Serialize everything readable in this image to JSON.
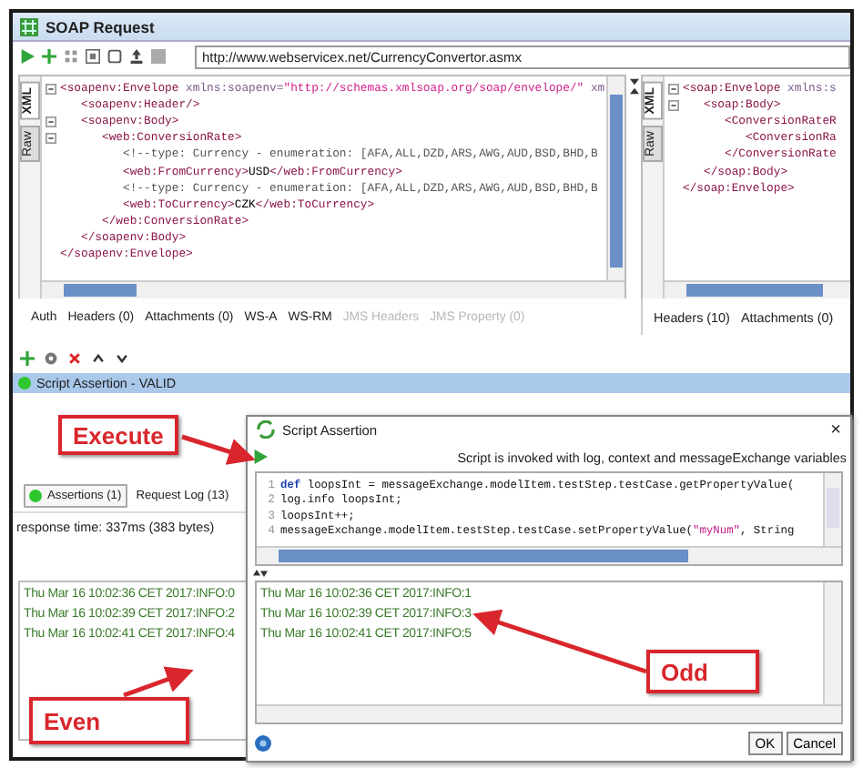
{
  "window": {
    "title": "SOAP Request"
  },
  "toolbar": {
    "url": "http://www.webservicex.net/CurrencyConvertor.asmx"
  },
  "request_pane": {
    "side_tabs": [
      {
        "label": "XML",
        "selected": true
      },
      {
        "label": "Raw",
        "selected": false
      }
    ],
    "lines": [
      {
        "fold": true,
        "parts": [
          {
            "kind": "tag",
            "text": "<soapenv:Envelope"
          },
          {
            "kind": "attr",
            "text": " xmlns:soapenv="
          },
          {
            "kind": "value",
            "text": "\"http://schemas.xmlsoap.org/soap/envelope/\""
          },
          {
            "kind": "attr",
            "text": " xm"
          }
        ]
      },
      {
        "fold": false,
        "parts": [
          {
            "kind": "tag",
            "text": "   <soapenv:Header/>"
          }
        ]
      },
      {
        "fold": true,
        "parts": [
          {
            "kind": "tag",
            "text": "   <soapenv:Body>"
          }
        ]
      },
      {
        "fold": true,
        "parts": [
          {
            "kind": "tag",
            "text": "      <web:ConversionRate>"
          }
        ]
      },
      {
        "fold": false,
        "parts": [
          {
            "kind": "comment",
            "text": "         <!--type: Currency - enumeration: [AFA,ALL,DZD,ARS,AWG,AUD,BSD,BHD,B"
          }
        ]
      },
      {
        "fold": false,
        "parts": [
          {
            "kind": "tag",
            "text": "         <web:FromCurrency>"
          },
          {
            "kind": "text",
            "text": "USD"
          },
          {
            "kind": "tag",
            "text": "</web:FromCurrency>"
          }
        ]
      },
      {
        "fold": false,
        "parts": [
          {
            "kind": "comment",
            "text": "         <!--type: Currency - enumeration: [AFA,ALL,DZD,ARS,AWG,AUD,BSD,BHD,B"
          }
        ]
      },
      {
        "fold": false,
        "parts": [
          {
            "kind": "tag",
            "text": "         <web:ToCurrency>"
          },
          {
            "kind": "text",
            "text": "CZK"
          },
          {
            "kind": "tag",
            "text": "</web:ToCurrency>"
          }
        ]
      },
      {
        "fold": false,
        "parts": [
          {
            "kind": "tag",
            "text": "      </web:ConversionRate>"
          }
        ]
      },
      {
        "fold": false,
        "parts": [
          {
            "kind": "tag",
            "text": "   </soapenv:Body>"
          }
        ]
      },
      {
        "fold": false,
        "parts": [
          {
            "kind": "tag",
            "text": "</soapenv:Envelope>"
          }
        ]
      }
    ]
  },
  "response_pane": {
    "side_tabs": [
      {
        "label": "XML",
        "selected": true
      },
      {
        "label": "Raw",
        "selected": false
      }
    ],
    "lines": [
      {
        "fold": true,
        "parts": [
          {
            "kind": "tag",
            "text": "<soap:Envelope"
          },
          {
            "kind": "attr",
            "text": " xmlns:s"
          }
        ]
      },
      {
        "fold": true,
        "parts": [
          {
            "kind": "tag",
            "text": "   <soap:Body>"
          }
        ]
      },
      {
        "fold": false,
        "parts": [
          {
            "kind": "tag",
            "text": "      <ConversionRateR"
          }
        ]
      },
      {
        "fold": false,
        "parts": [
          {
            "kind": "tag",
            "text": "         <ConversionRa"
          }
        ]
      },
      {
        "fold": false,
        "parts": [
          {
            "kind": "tag",
            "text": "      </ConversionRate"
          }
        ]
      },
      {
        "fold": false,
        "parts": [
          {
            "kind": "tag",
            "text": "   </soap:Body>"
          }
        ]
      },
      {
        "fold": false,
        "parts": [
          {
            "kind": "tag",
            "text": "</soap:Envelope>"
          }
        ]
      }
    ]
  },
  "request_tabs": [
    {
      "label": "Auth",
      "disabled": false
    },
    {
      "label": "Headers (0)",
      "disabled": false
    },
    {
      "label": "Attachments (0)",
      "disabled": false
    },
    {
      "label": "WS-A",
      "disabled": false
    },
    {
      "label": "WS-RM",
      "disabled": false
    },
    {
      "label": "JMS Headers",
      "disabled": true
    },
    {
      "label": "JMS Property (0)",
      "disabled": true
    }
  ],
  "response_tabs": [
    {
      "label": "Headers (10)",
      "disabled": false
    },
    {
      "label": "Attachments (0)",
      "disabled": false
    }
  ],
  "assertion": {
    "label": "Script Assertion - VALID",
    "selected": true
  },
  "log_tabs": [
    {
      "label": "Assertions (1)",
      "selected": true
    },
    {
      "label": "Request Log (13)",
      "selected": false
    }
  ],
  "response_time": "response time: 337ms (383 bytes)",
  "even_log": [
    "Thu Mar 16 10:02:36 CET 2017:INFO:0",
    "Thu Mar 16 10:02:39 CET 2017:INFO:2",
    "Thu Mar 16 10:02:41 CET 2017:INFO:4"
  ],
  "dialog": {
    "title": "Script Assertion",
    "close": "×",
    "info": "Script is invoked with log, context and messageExchange variables",
    "code": [
      {
        "number": "1",
        "parts": [
          {
            "kind": "keyword",
            "text": "def"
          },
          {
            "kind": "plain",
            "text": " loopsInt = messageExchange.modelItem.testStep.testCase.getPropertyValue("
          }
        ]
      },
      {
        "number": "2",
        "parts": [
          {
            "kind": "plain",
            "text": "log.info loopsInt;"
          }
        ]
      },
      {
        "number": "3",
        "parts": [
          {
            "kind": "plain",
            "text": "loopsInt++;"
          }
        ]
      },
      {
        "number": "4",
        "parts": [
          {
            "kind": "plain",
            "text": "messageExchange.modelItem.testStep.testCase.setPropertyValue("
          },
          {
            "kind": "string",
            "text": "\"myNum\""
          },
          {
            "kind": "plain",
            "text": ", String"
          }
        ]
      }
    ],
    "log": [
      "Thu Mar 16 10:02:36 CET 2017:INFO:1",
      "Thu Mar 16 10:02:39 CET 2017:INFO:3",
      "Thu Mar 16 10:02:41 CET 2017:INFO:5"
    ],
    "buttons": [
      "OK",
      "Cancel"
    ]
  },
  "callouts": [
    {
      "label": "Execute",
      "kind": "execute"
    },
    {
      "label": "Even",
      "kind": "even"
    },
    {
      "label": "Odd",
      "kind": "odd"
    }
  ]
}
